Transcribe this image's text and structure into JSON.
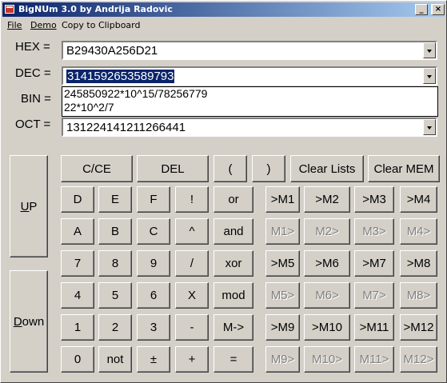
{
  "window": {
    "title": "BigNUm 3.0 by Andrija Radovic",
    "controls": {
      "minimize": "_",
      "maximize": "□",
      "close": "×"
    }
  },
  "menu": {
    "file": "File",
    "demo": "Demo",
    "copy": "Copy to Clipboard"
  },
  "fields": {
    "hex": {
      "label": "HEX =",
      "value": "B29430A256D21"
    },
    "dec": {
      "label": "DEC =",
      "value": "3141592653589793"
    },
    "bin": {
      "label": "BIN ="
    },
    "oct": {
      "label": "OCT =",
      "value": "131224141211266441"
    }
  },
  "dec_history": [
    "245850922*10^15/78256779",
    "22*10^2/7"
  ],
  "side_buttons": {
    "up_u": "U",
    "up_rest": "P",
    "down_d": "D",
    "down_rest": "own"
  },
  "top_row": [
    "C/CE",
    "DEL",
    "(",
    ")",
    "Clear Lists",
    "Clear MEM"
  ],
  "keypad": [
    [
      "D",
      "E",
      "F",
      "!",
      "or"
    ],
    [
      "A",
      "B",
      "C",
      "^",
      "and"
    ],
    [
      "7",
      "8",
      "9",
      "/",
      "xor"
    ],
    [
      "4",
      "5",
      "6",
      "X",
      "mod"
    ],
    [
      "1",
      "2",
      "3",
      "-",
      "M->"
    ],
    [
      "0",
      "not",
      "±",
      "+",
      "="
    ]
  ],
  "memory": [
    [
      ">M1",
      ">M2",
      ">M3",
      ">M4"
    ],
    [
      "M1>",
      "M2>",
      "M3>",
      "M4>"
    ],
    [
      ">M5",
      ">M6",
      ">M7",
      ">M8"
    ],
    [
      "M5>",
      "M6>",
      "M7>",
      "M8>"
    ],
    [
      ">M9",
      ">M10",
      ">M11",
      ">M12"
    ],
    [
      "M9>",
      "M10>",
      "M11>",
      "M12>"
    ]
  ]
}
